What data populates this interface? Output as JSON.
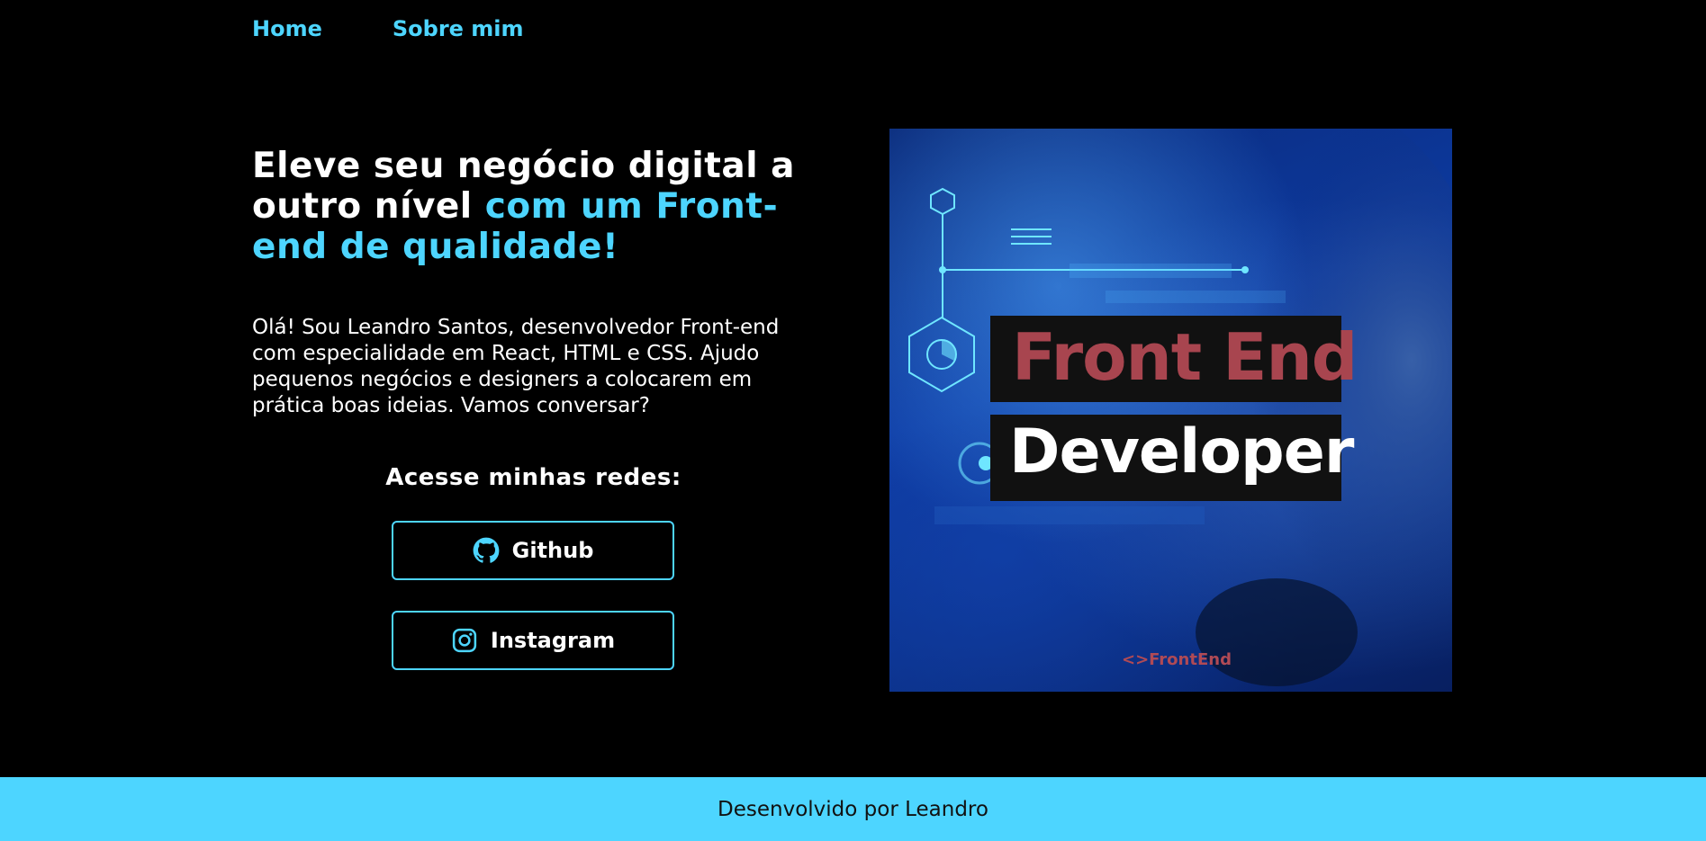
{
  "nav": {
    "items": [
      {
        "label": "Home"
      },
      {
        "label": "Sobre mim"
      }
    ]
  },
  "hero": {
    "headline_part1": "Eleve seu negócio digital a outro nível ",
    "headline_part2": "com um Front-end de qualidade!",
    "intro": "Olá! Sou Leandro Santos, desenvolvedor Front-end com especialidade em React, HTML e CSS. Ajudo pequenos negócios e designers a colocarem em prática boas ideias. Vamos conversar?",
    "image": {
      "line1": "Front End",
      "line2": "Developer",
      "brand": "<>FrontEnd"
    }
  },
  "social": {
    "title": "Acesse minhas redes:",
    "buttons": [
      {
        "label": "Github",
        "icon": "github-icon"
      },
      {
        "label": "Instagram",
        "icon": "instagram-icon"
      }
    ]
  },
  "footer": {
    "text": "Desenvolvido por Leandro"
  },
  "colors": {
    "accent": "#4dd5ff",
    "background": "#000000",
    "footer_bg": "#4dd5ff"
  }
}
